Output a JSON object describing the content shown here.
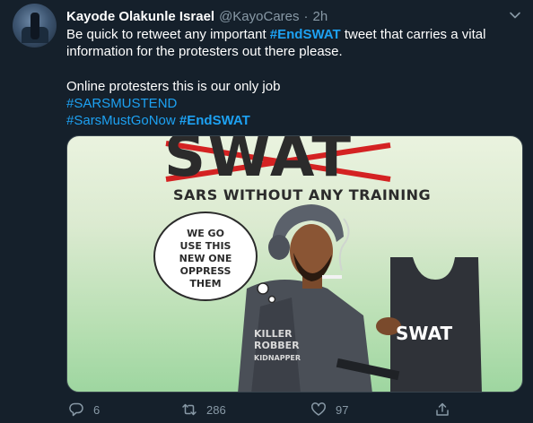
{
  "tweet": {
    "author_name": "Kayode Olakunle Israel",
    "author_handle": "@KayoCares",
    "separator": "·",
    "time": "2h",
    "text": {
      "line1_pre": "Be quick to retweet any important ",
      "line1_hashtag": "#EndSWAT",
      "line1_post": " tweet that carries a vital information for the protesters out there please.",
      "para2": "Online protesters this is our only job",
      "hashtag_a": "#SARSMUSTEND",
      "hashtag_b": "#SarsMustGoNow",
      "hashtag_c": "#EndSWAT"
    },
    "media": {
      "title_word": "SWAT",
      "caption": "SARS  WITHOUT  ANY  TRAINING",
      "bubble_lines": "WE GO\nUSE THIS\nNEW ONE\nOPPRESS\nTHEM",
      "vest_label": "SWAT",
      "jacket_line1": "KILLER",
      "jacket_line2": "ROBBER",
      "jacket_line3": "KIDNAPPER"
    },
    "actions": {
      "replies": "6",
      "retweets": "286",
      "likes": "97"
    }
  },
  "colors": {
    "background": "#15202b",
    "text_primary": "#ffffff",
    "text_secondary": "#8899a6",
    "link": "#1da1f2",
    "border": "#38444d"
  },
  "icons": [
    "chevron-down-icon",
    "reply-icon",
    "retweet-icon",
    "heart-icon",
    "share-icon"
  ]
}
